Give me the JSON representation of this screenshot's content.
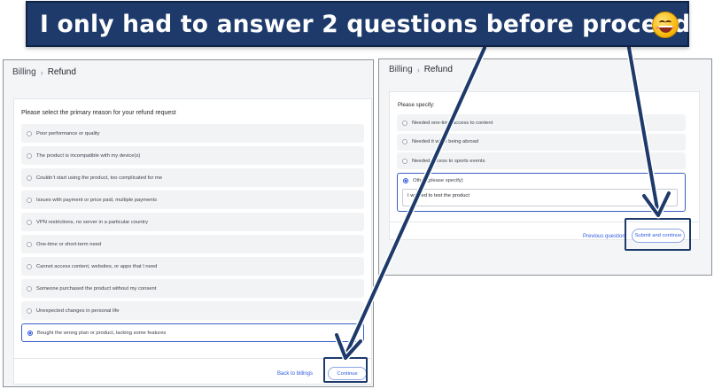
{
  "banner": {
    "text": "I only had to answer 2 questions before proceeding",
    "emoji": "grinning-face-emoji"
  },
  "left_panel": {
    "breadcrumb": [
      "Billing",
      "Refund"
    ],
    "question": "Please select the primary reason for your refund request",
    "options": [
      "Poor performance or quality",
      "The product is incompatible with my device(s)",
      "Couldn’t start using the product, too complicated for me",
      "Issues with payment or price paid, multiple payments",
      "VPN restrictions, no server in a particular country",
      "One-time or short-term need",
      "Cannot access content, websites, or apps that I need",
      "Someone purchased the product without my consent",
      "Unexpected changes in personal life",
      "Bought the wrong plan or product, lacking some features"
    ],
    "selected_index": 9,
    "back_label": "Back to billings",
    "continue_label": "Continue"
  },
  "right_panel": {
    "breadcrumb": [
      "Billing",
      "Refund"
    ],
    "question": "Please specify:",
    "options": [
      "Needed one-time access to content",
      "Needed it while being abroad",
      "Needed access to sports events"
    ],
    "other_label": "Other (please specify)",
    "other_value": "I wanted to test the product",
    "previous_label": "Previous question",
    "submit_label": "Submit and continue"
  },
  "colors": {
    "banner": "#1d3a6b",
    "accent": "#2f5be0",
    "arrow": "#1d3a6b"
  }
}
